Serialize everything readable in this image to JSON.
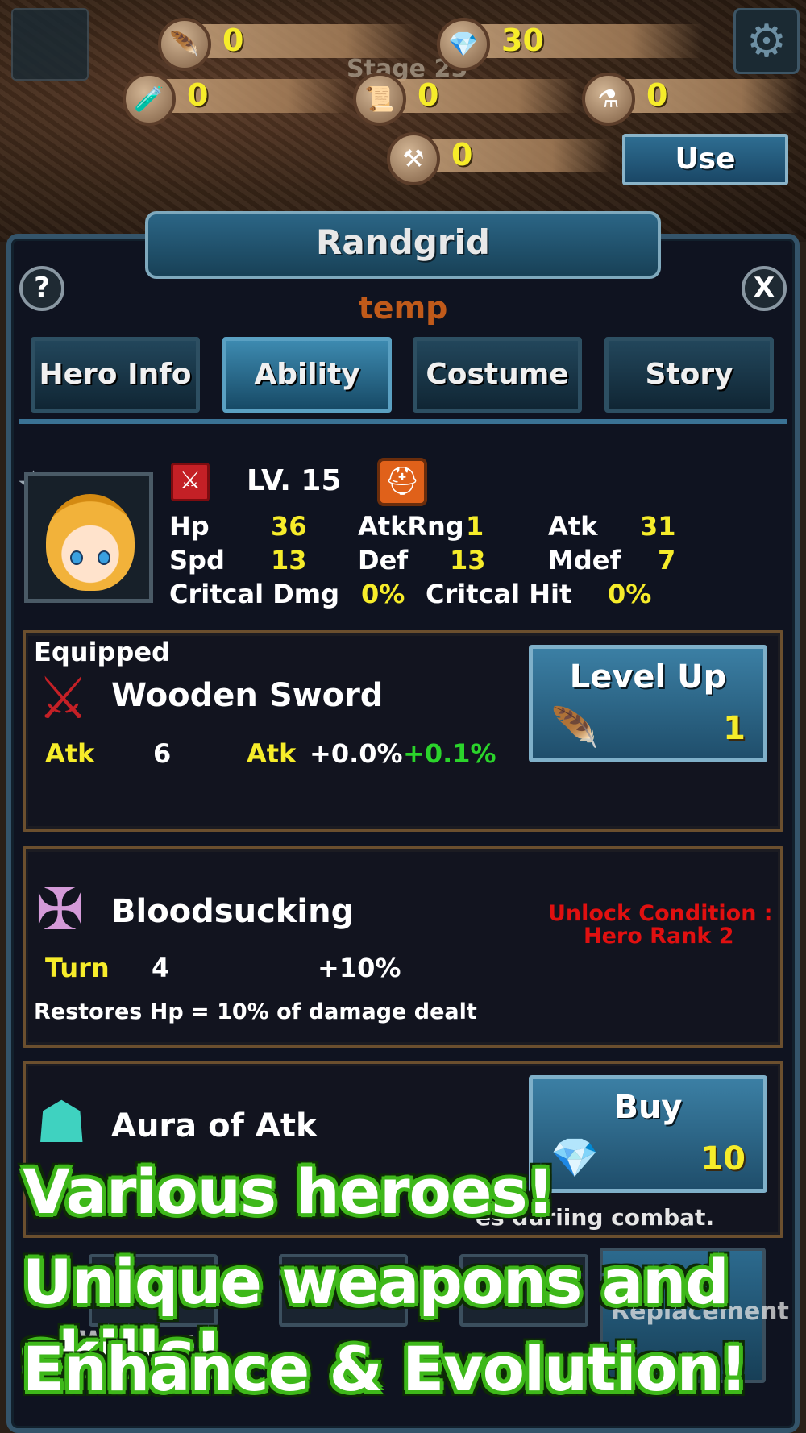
{
  "resources": {
    "feather": {
      "icon": "feather-icon",
      "value": "0"
    },
    "gem": {
      "icon": "gem-icon",
      "value": "30"
    },
    "potion": {
      "icon": "potion-icon",
      "value": "0"
    },
    "scroll": {
      "icon": "scroll-icon",
      "value": "0"
    },
    "bottle": {
      "icon": "bottle-icon",
      "value": "0"
    },
    "anvil": {
      "icon": "anvil-icon",
      "value": "0"
    },
    "use_label": "Use"
  },
  "background": {
    "stage_text": "Stage 25"
  },
  "panel": {
    "title": "Randgrid",
    "subtitle": "temp",
    "help_label": "?",
    "close_label": "X",
    "tabs": [
      "Hero Info",
      "Ability",
      "Costume",
      "Story"
    ],
    "active_tab": "Ability"
  },
  "hero": {
    "level": "LV. 15",
    "stats": {
      "hp_label": "Hp",
      "hp": "36",
      "atkrng_label": "AtkRng",
      "atkrng": "1",
      "atk_label": "Atk",
      "atk": "31",
      "spd_label": "Spd",
      "spd": "13",
      "def_label": "Def",
      "def": "13",
      "mdef_label": "Mdef",
      "mdef": "7",
      "crit_dmg_label": "Critcal Dmg",
      "crit_dmg": "0%",
      "crit_hit_label": "Critcal Hit",
      "crit_hit": "0%"
    }
  },
  "weapon": {
    "equipped_label": "Equipped",
    "name": "Wooden Sword",
    "stat1_label": "Atk",
    "stat1_value": "6",
    "stat2_label": "Atk",
    "stat2_value": "+0.0%",
    "stat2_bonus": "+0.1%",
    "action_label": "Level Up",
    "action_cost": "1"
  },
  "skill1": {
    "name": "Bloodsucking",
    "turn_label": "Turn",
    "turn_value": "4",
    "effect": "+10%",
    "desc": "Restores Hp = 10% of damage dealt",
    "unlock_line1": "Unlock Condition :",
    "unlock_line2": "Hero Rank 2"
  },
  "skill2": {
    "name": "Aura of Atk",
    "desc_partial": "es duriing combat.",
    "action_label": "Buy",
    "action_cost": "10"
  },
  "bottom": {
    "wooden_label": "Wooden",
    "replacement_label": "Replacement"
  },
  "promo": {
    "line1": "Various heroes!",
    "line2": "Unique weapons and skills!",
    "line3": "Enhance & Evolution!"
  },
  "colors": {
    "accent_yellow": "#f6ec2a",
    "bonus_green": "#2bd42b",
    "unlock_red": "#e01010",
    "subtitle_orange": "#c05a1a"
  }
}
